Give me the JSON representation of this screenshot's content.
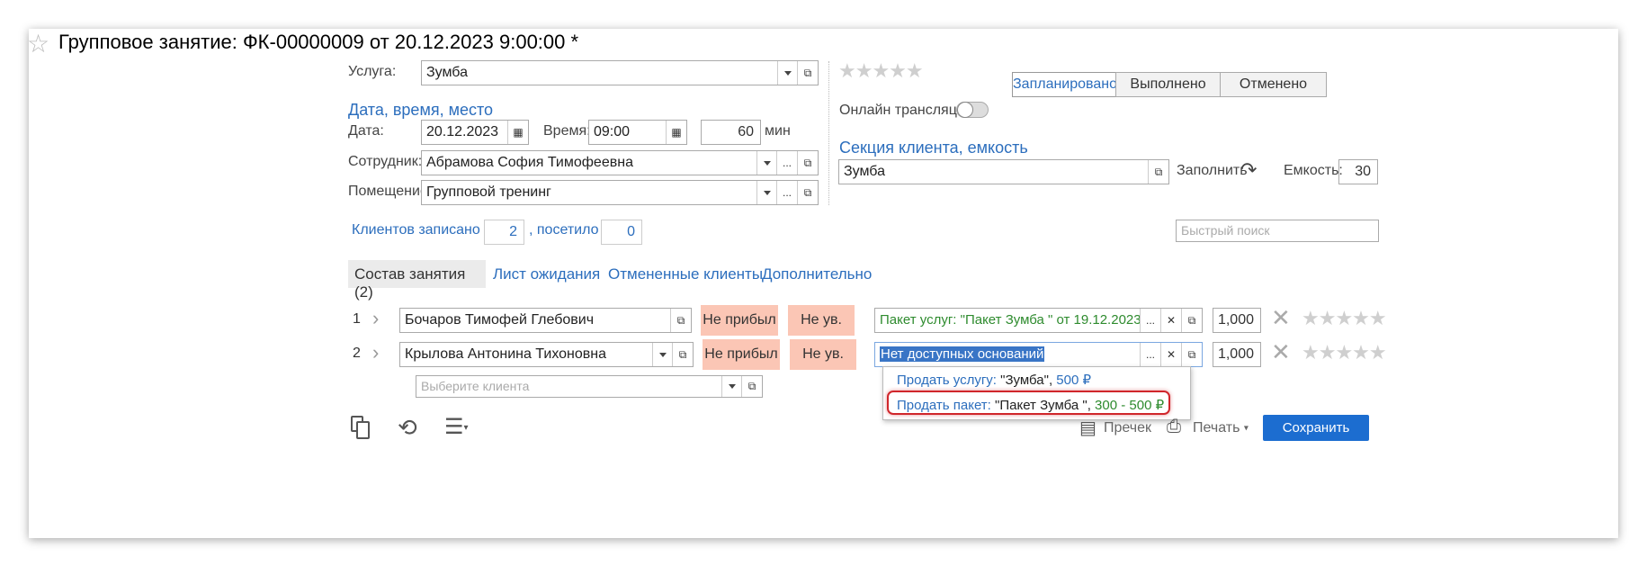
{
  "window": {
    "title": "Групповое занятие: ФК-00000009 от 20.12.2023 9:00:00 *"
  },
  "service": {
    "label": "Услуга:",
    "value": "Зумба"
  },
  "status_buttons": [
    "Запланировано",
    "Выполнено",
    "Отменено"
  ],
  "datetime": {
    "section_title": "Дата, время, место",
    "date_label": "Дата:",
    "date_value": "20.12.2023",
    "time_label": "Время:",
    "time_value": "09:00",
    "duration_value": "60",
    "duration_unit": "мин"
  },
  "employee": {
    "label": "Сотрудник:",
    "value": "Абрамова София Тимофеевна"
  },
  "room": {
    "label": "Помещение:",
    "value": "Групповой тренинг"
  },
  "online": {
    "label": "Онлайн трансляция:"
  },
  "section": {
    "title": "Секция клиента, емкость",
    "value": "Зумба",
    "fill_label": "Заполнить",
    "capacity_label": "Емкость:",
    "capacity_value": "30"
  },
  "counts": {
    "registered_label": "Клиентов записано",
    "registered_value": "2",
    "visited_label": ", посетило",
    "visited_value": "0"
  },
  "search": {
    "placeholder": "Быстрый поиск"
  },
  "tabs": [
    "Состав занятия (2)",
    "Лист ожидания",
    "Отмененные клиенты",
    "Дополнительно"
  ],
  "rows": [
    {
      "num": "1",
      "client": "Бочаров Тимофей Глебович",
      "not_arrived": "Не прибыл",
      "unexcused": "Не ув.",
      "basis": "Пакет услуг: \"Пакет Зумба \" от 19.12.2023",
      "qty": "1,000"
    },
    {
      "num": "2",
      "client": "Крылова Антонина Тихоновна",
      "not_arrived": "Не прибыл",
      "unexcused": "Не ув.",
      "basis": "Нет доступных оснований",
      "qty": "1,000"
    }
  ],
  "new_client": {
    "placeholder": "Выберите клиента"
  },
  "dropdown": {
    "item1": {
      "prefix": "Продать услугу:",
      "name": "\"Зумба\"",
      "sep": ", ",
      "price": "500 ₽"
    },
    "item2": {
      "prefix": "Продать пакет:",
      "name": "\"Пакет Зумба \"",
      "sep": ", ",
      "price": "300 - 500 ₽"
    }
  },
  "footer": {
    "receipt_label": "Пречек",
    "print_label": "Печать",
    "save_label": "Сохранить"
  },
  "colors": {
    "accent": "#2c6ebd",
    "save": "#1c6dd0",
    "peach": "#fbc6b5",
    "green": "#2e8b2e",
    "highlight_border": "#d0262b"
  }
}
